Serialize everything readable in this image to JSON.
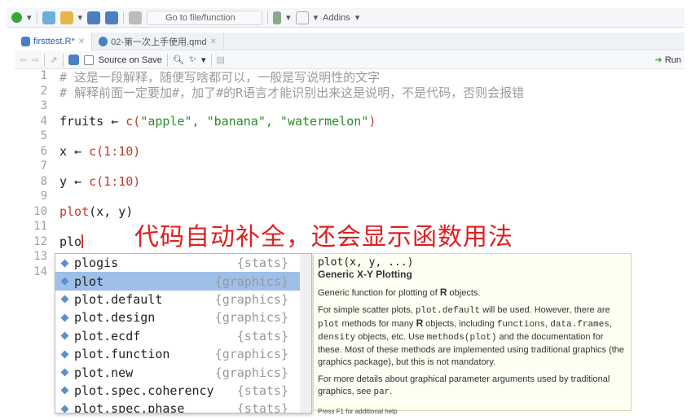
{
  "toolbar": {
    "goto_placeholder": "Go to file/function",
    "addins": "Addins"
  },
  "tabs": [
    {
      "label": "firsttest.R*",
      "active": true
    },
    {
      "label": "02-第一次上手使用.qmd",
      "active": false
    }
  ],
  "editor_toolbar": {
    "source_on_save": "Source on Save",
    "run": "Run"
  },
  "code": {
    "l1": "# 这是一段解释，随便写啥都可以，一般是写说明性的文字",
    "l2": "# 解释前面一定要加#，加了#的R语言才能识别出来这是说明，不是代码，否则会报错",
    "l4a": "fruits ← ",
    "l4b": "c(",
    "l4c": "\"apple\", \"banana\", \"watermelon\"",
    "l4d": ")",
    "l6a": "x ← ",
    "l6b": "c(1:10)",
    "l8a": "y ← ",
    "l8b": "c(1:10)",
    "l10a": "plot",
    "l10b": "(x, y)",
    "l12": "plo"
  },
  "annotation": "代码自动补全，还会显示函数用法",
  "completions": [
    {
      "name": "plogis",
      "pkg": "{stats}"
    },
    {
      "name": "plot",
      "pkg": "{graphics}",
      "selected": true
    },
    {
      "name": "plot.default",
      "pkg": "{graphics}"
    },
    {
      "name": "plot.design",
      "pkg": "{graphics}"
    },
    {
      "name": "plot.ecdf",
      "pkg": "{stats}"
    },
    {
      "name": "plot.function",
      "pkg": "{graphics}"
    },
    {
      "name": "plot.new",
      "pkg": "{graphics}"
    },
    {
      "name": "plot.spec.coherency",
      "pkg": "{stats}"
    },
    {
      "name": "plot.spec.phase",
      "pkg": "{stats}"
    }
  ],
  "help": {
    "signature": "plot(x, y, ...)",
    "title": "Generic X-Y Plotting",
    "p1a": "Generic function for plotting of ",
    "p1b": "R",
    "p1c": " objects.",
    "p2a": "For simple scatter plots, ",
    "p2b": "plot.default",
    "p2c": " will be used. However, there are ",
    "p2d": "plot",
    "p2e": " methods for many ",
    "p2f": "R",
    "p2g": " objects, including ",
    "p2h": "functions",
    "p2i": ", ",
    "p2j": "data.frames",
    "p2k": ", ",
    "p2l": "density",
    "p2m": " objects, etc. Use ",
    "p2n": "methods(plot)",
    "p2o": " and the documentation for these. Most of these methods are implemented using traditional graphics (the graphics package), but this is not mandatory.",
    "p3a": "For more details about graphical parameter arguments used by traditional graphics, see ",
    "p3b": "par",
    "p3c": ".",
    "footer": "Press F1 for additional help"
  }
}
